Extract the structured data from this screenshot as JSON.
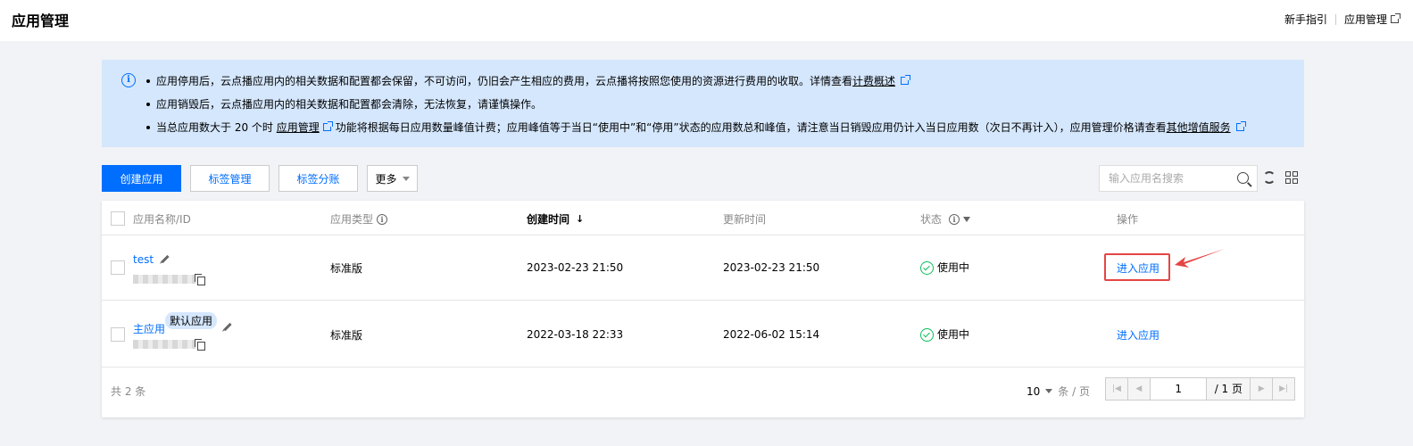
{
  "header": {
    "title": "应用管理",
    "links": [
      {
        "label": "新手指引"
      },
      {
        "label": "应用管理"
      }
    ]
  },
  "notice": {
    "line1_text": "应用停用后，云点播应用内的相关数据和配置都会保留，不可访问，仍旧会产生相应的费用，云点播将按照您使用的资源进行费用的收取。详情查看",
    "line1_link": "计费概述",
    "line2_text": "应用销毁后，云点播应用内的相关数据和配置都会清除，无法恢复，请谨慎操作。",
    "line3_prefix": "当总应用数大于 20 个时",
    "line3_link1": "应用管理",
    "line3_middle": "功能将根据每日应用数量峰值计费；应用峰值等于当日“使用中”和“停用”状态的应用数总和峰值，请注意当日销毁应用仍计入当日应用数（次日不再计入），应用管理价格请查看",
    "line3_link2": "其他增值服务"
  },
  "toolbar": {
    "create_label": "创建应用",
    "tag_manage_label": "标签管理",
    "tag_bill_label": "标签分账",
    "more_label": "更多",
    "search_placeholder": "输入应用名搜索"
  },
  "table": {
    "columns": [
      "应用名称/ID",
      "应用类型",
      "创建时间",
      "更新时间",
      "状态",
      "操作"
    ],
    "rows": [
      {
        "name": "test",
        "tag": "",
        "type": "标准版",
        "created": "2023-02-23 21:50",
        "updated": "2023-02-23 21:50",
        "status": "使用中",
        "action": "进入应用"
      },
      {
        "name": "主应用",
        "tag": "默认应用",
        "type": "标准版",
        "created": "2022-03-18 22:33",
        "updated": "2022-06-02 15:14",
        "status": "使用中",
        "action": "进入应用"
      }
    ]
  },
  "footer": {
    "total_label": "共 2 条",
    "page_size": "10",
    "page_size_unit": "条 / 页",
    "current_page": "1",
    "total_pages": "/ 1 页"
  },
  "colors": {
    "primary": "#006eff",
    "notice_bg": "#d5e7fd",
    "status_ok": "#0abf5b",
    "highlight": "#e54545"
  }
}
